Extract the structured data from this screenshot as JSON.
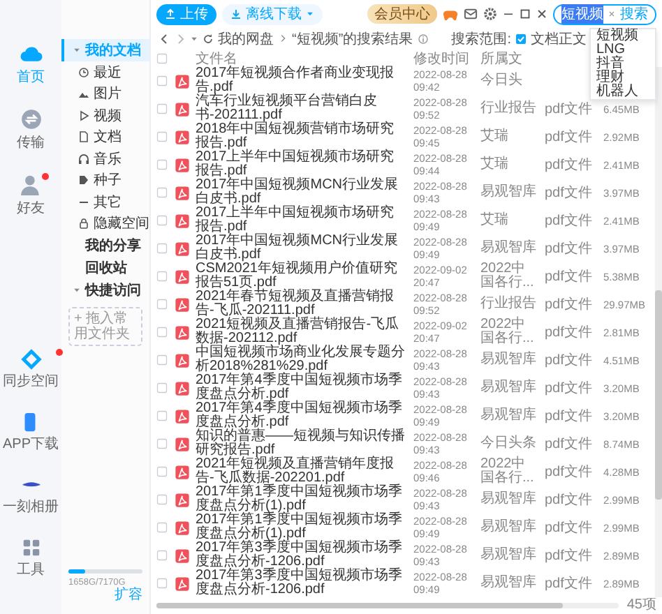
{
  "rail": {
    "top": [
      {
        "label": "首页",
        "selected": true,
        "badge": false
      },
      {
        "label": "传输",
        "selected": false,
        "badge": false
      },
      {
        "label": "好友",
        "selected": false,
        "badge": true
      }
    ],
    "bottom": [
      {
        "label": "同步空间",
        "badge": true
      },
      {
        "label": "APP下载",
        "badge": false
      },
      {
        "label": "一刻相册",
        "badge": false
      },
      {
        "label": "工具",
        "badge": false
      }
    ]
  },
  "nav": {
    "items": [
      {
        "label": "我的文档",
        "selected": true,
        "expanded": true,
        "children": [
          {
            "label": "最近",
            "selected": false
          },
          {
            "label": "图片",
            "selected": false
          },
          {
            "label": "视频",
            "selected": false
          },
          {
            "label": "文档",
            "selected": false
          },
          {
            "label": "音乐",
            "selected": false
          },
          {
            "label": "种子",
            "selected": false
          },
          {
            "label": "其它",
            "selected": false
          },
          {
            "label": "隐藏空间",
            "selected": false
          }
        ]
      },
      {
        "label": "我的分享",
        "selected": false
      },
      {
        "label": "回收站",
        "selected": false
      },
      {
        "label": "快捷访问",
        "selected": false,
        "expanded": true
      }
    ],
    "drop_hint": "+ 拖入常用文件夹",
    "storage": {
      "usage": "1658G/7170G",
      "level": 0.22,
      "action": "扩容"
    }
  },
  "header": {
    "vip": "会员中心"
  },
  "toolbar": {
    "upload": "上传",
    "offline": "离线下载",
    "search": {
      "value": "短视频",
      "action": "搜索",
      "suggestions": [
        "短视频",
        "LNG",
        "抖音",
        "理财",
        "机器人"
      ]
    }
  },
  "breadcrumb": {
    "path": [
      "我的网盘",
      "“短视频”的搜索结果"
    ],
    "scope_label": "搜索范围:",
    "scope": {
      "label": "文档正文",
      "checked": true
    }
  },
  "table": {
    "select_all": false,
    "columns": [
      "文件名",
      "修改时间",
      "所属文"
    ],
    "rows": [
      {
        "name": "2017年短视频合作者商业变现报告.pdf",
        "modified": "2022-08-28 09:42",
        "source": "今日头",
        "checked": false
      },
      {
        "name": "汽车行业短视频平台营销白皮书-202111.pdf",
        "modified": "2022-08-28 09:52",
        "source": "行业报告",
        "type": "pdf文件",
        "size": "6.45MB",
        "checked": false
      },
      {
        "name": "2018年中国短视频营销市场研究报告.pdf",
        "modified": "2022-08-28 09:45",
        "source": "艾瑞",
        "type": "pdf文件",
        "size": "2.92MB",
        "checked": false
      },
      {
        "name": "2017上半年中国短视频市场研究报告.pdf",
        "modified": "2022-08-28 09:44",
        "source": "艾瑞",
        "type": "pdf文件",
        "size": "2.41MB",
        "checked": false
      },
      {
        "name": "2017年中国短视频MCN行业发展白皮书.pdf",
        "modified": "2022-08-28 09:43",
        "source": "易观智库",
        "type": "pdf文件",
        "size": "3.97MB",
        "checked": false
      },
      {
        "name": "2017上半年中国短视频市场研究报告.pdf",
        "modified": "2022-08-28 09:49",
        "source": "艾瑞",
        "type": "pdf文件",
        "size": "2.41MB",
        "checked": false
      },
      {
        "name": "2017年中国短视频MCN行业发展白皮书.pdf",
        "modified": "2022-08-28 09:49",
        "source": "易观智库",
        "type": "pdf文件",
        "size": "3.97MB",
        "checked": false
      },
      {
        "name": "CSM2021年短视频用户价值研究报告51页.pdf",
        "modified": "2022-09-02 20:47",
        "source": "2022中国各行...",
        "type": "pdf文件",
        "size": "5.38MB",
        "checked": false
      },
      {
        "name": "2021年春节短视频及直播营销报告-飞瓜-202111.pdf",
        "modified": "2022-08-28 09:52",
        "source": "行业报告",
        "type": "pdf文件",
        "size": "29.97MB",
        "checked": false
      },
      {
        "name": "2021短视频及直播营销报告-飞瓜数据-202112.pdf",
        "modified": "2022-09-02 20:47",
        "source": "2022中国各行...",
        "type": "pdf文件",
        "size": "2.81MB",
        "checked": false
      },
      {
        "name": "中国短视频市场商业化发展专题分析2018%281%29.pdf",
        "modified": "2022-08-28 09:43",
        "source": "易观智库",
        "type": "pdf文件",
        "size": "4.51MB",
        "checked": false
      },
      {
        "name": "2017年第4季度中国短视频市场季度盘点分析.pdf",
        "modified": "2022-08-28 09:43",
        "source": "易观智库",
        "type": "pdf文件",
        "size": "3.20MB",
        "checked": false
      },
      {
        "name": "2017年第4季度中国短视频市场季度盘点分析.pdf",
        "modified": "2022-08-28 09:49",
        "source": "易观智库",
        "type": "pdf文件",
        "size": "3.20MB",
        "checked": false
      },
      {
        "name": "知识的普惠——短视频与知识传播研究报告.pdf",
        "modified": "2022-08-28 09:43",
        "source": "今日头条",
        "type": "pdf文件",
        "size": "8.74MB",
        "checked": false
      },
      {
        "name": "2021年短视频及直播营销年度报告-飞瓜数据-202201.pdf",
        "modified": "2022-08-28 09:46",
        "source": "2022中国各行...",
        "type": "pdf文件",
        "size": "4.28MB",
        "checked": false
      },
      {
        "name": "2017年第1季度中国短视频市场季度盘点分析(1).pdf",
        "modified": "2022-08-28 09:43",
        "source": "易观智库",
        "type": "pdf文件",
        "size": "2.99MB",
        "checked": false
      },
      {
        "name": "2017年第1季度中国短视频市场季度盘点分析(1).pdf",
        "modified": "2022-08-28 09:49",
        "source": "易观智库",
        "type": "pdf文件",
        "size": "2.99MB",
        "checked": false
      },
      {
        "name": "2017年第3季度中国短视频市场季度盘点分析-1206.pdf",
        "modified": "2022-08-28 09:43",
        "source": "易观智库",
        "type": "pdf文件",
        "size": "2.89MB",
        "checked": false
      },
      {
        "name": "2017年第3季度中国短视频市场季度盘点分析-1206.pdf",
        "modified": "2022-08-28 09:49",
        "source": "易观智库",
        "type": "pdf文件",
        "size": "2.89MB",
        "checked": false
      }
    ]
  },
  "status_bar": {
    "count": "45项"
  }
}
